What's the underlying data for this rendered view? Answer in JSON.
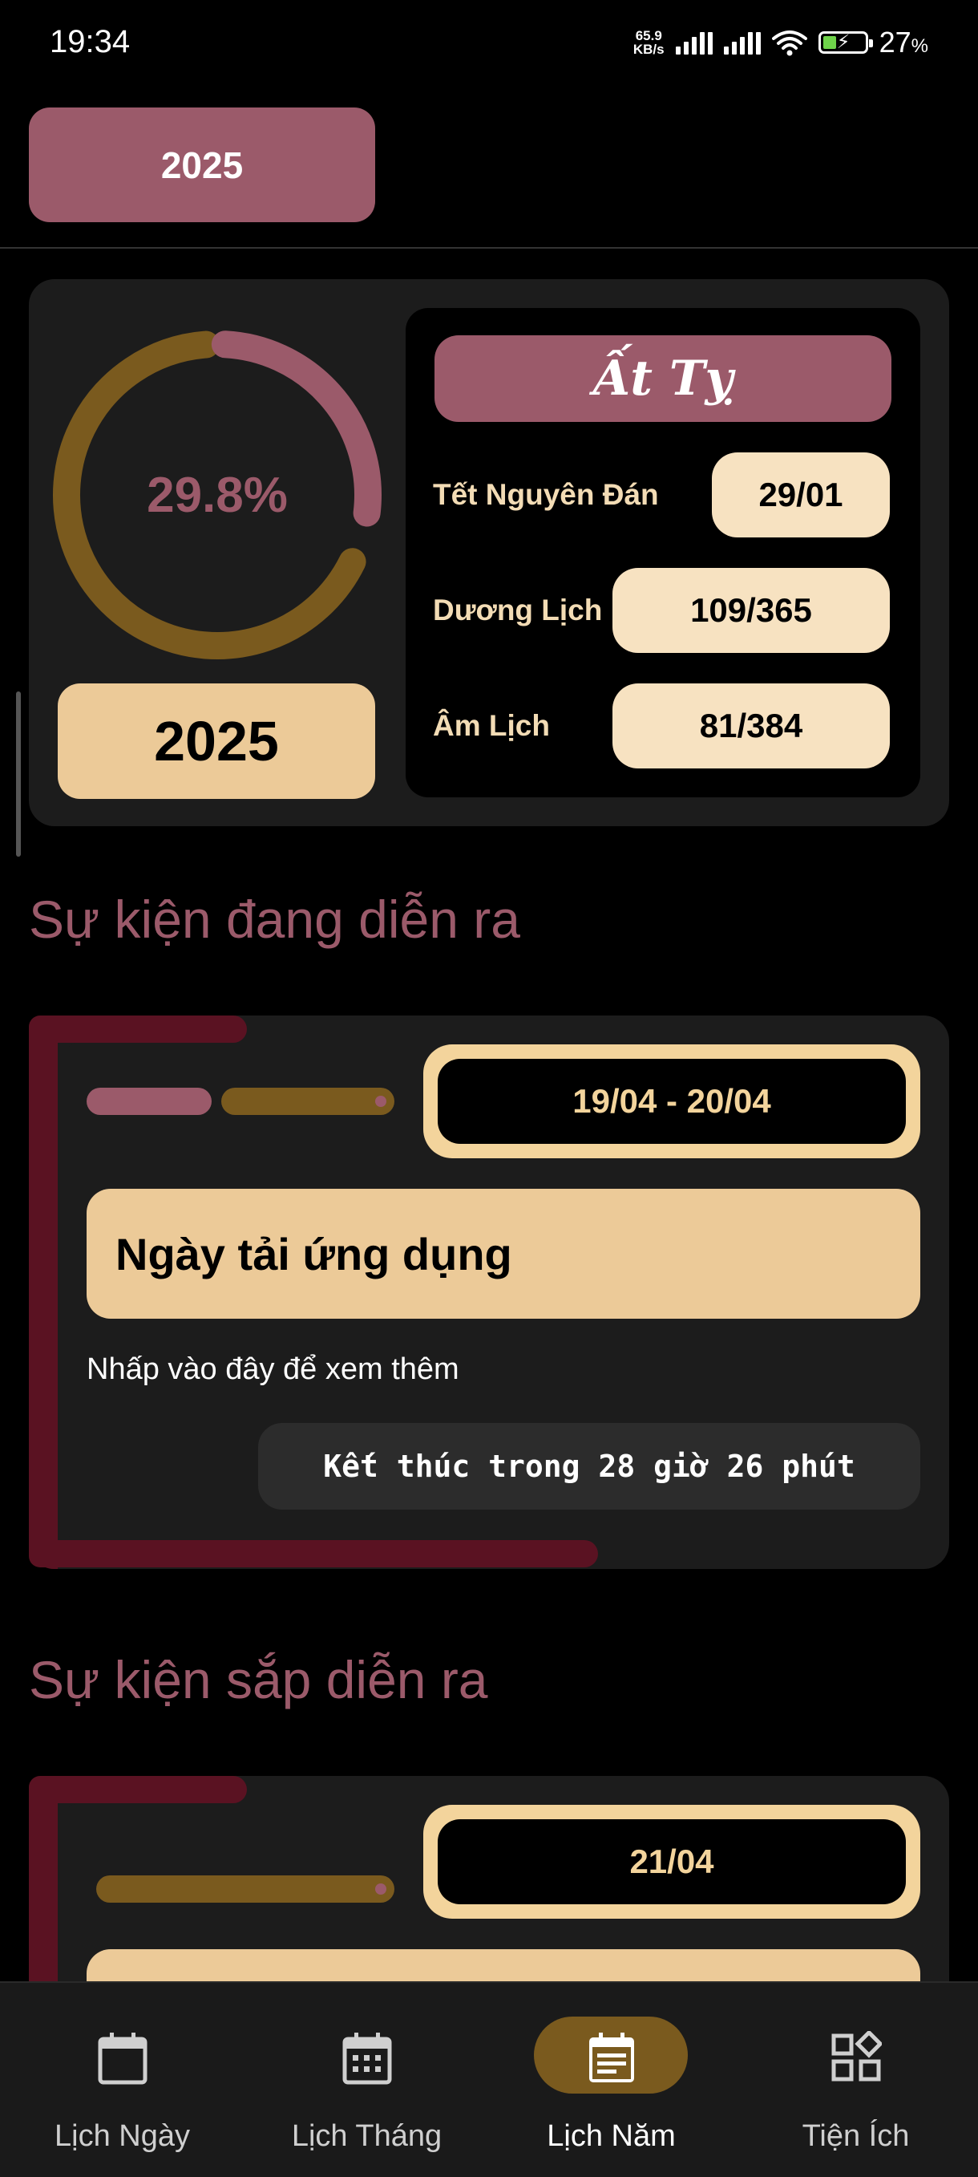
{
  "status_bar": {
    "time": "19:34",
    "net_speed_value": "65.9",
    "net_speed_unit": "KB/s",
    "battery_percent": "27",
    "battery_unit": "%"
  },
  "header": {
    "year_button": "2025"
  },
  "summary": {
    "progress_percent_text": "29.8%",
    "progress_fraction": 0.298,
    "year": "2025",
    "can_chi": "Ất Tỵ",
    "rows": [
      {
        "label": "Tết Nguyên Đán",
        "value": "29/01"
      },
      {
        "label": "Dương Lịch",
        "value": "109/365"
      },
      {
        "label": "Âm Lịch",
        "value": "81/384"
      }
    ]
  },
  "sections": {
    "ongoing_title": "Sự kiện đang diễn ra",
    "upcoming_title": "Sự kiện sắp diễn ra"
  },
  "ongoing_event": {
    "date_range": "19/04 - 20/04",
    "title": "Ngày tải ứng dụng",
    "hint": "Nhấp vào đây để xem thêm",
    "countdown": "Kết thúc trong 28 giờ 26 phút"
  },
  "upcoming_event": {
    "date": "21/04"
  },
  "colors": {
    "accent_pink": "#9b5a6a",
    "accent_brown": "#7a5a1e",
    "cream": "#ecca98",
    "dark_red": "#5a1222",
    "card": "#1c1c1c"
  },
  "nav": {
    "items": [
      {
        "label": "Lịch Ngày",
        "icon": "calendar-day-icon"
      },
      {
        "label": "Lịch Tháng",
        "icon": "calendar-month-icon"
      },
      {
        "label": "Lịch Năm",
        "icon": "calendar-year-icon",
        "active": true
      },
      {
        "label": "Tiện Ích",
        "icon": "widgets-icon"
      }
    ]
  }
}
